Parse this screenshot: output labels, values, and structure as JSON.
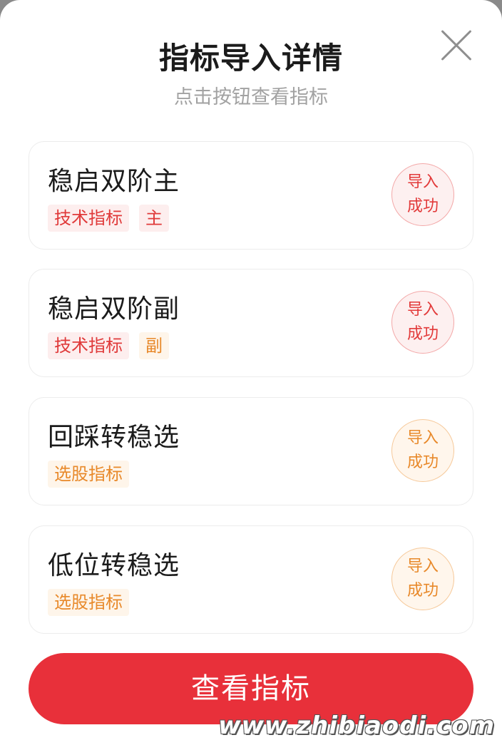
{
  "header": {
    "title": "指标导入详情",
    "subtitle": "点击按钮查看指标"
  },
  "items": [
    {
      "name": "稳启双阶主",
      "tags": [
        {
          "text": "技术指标",
          "color": "red"
        },
        {
          "text": "主",
          "color": "red"
        }
      ],
      "status": {
        "line1": "导入",
        "line2": "成功",
        "color": "red"
      }
    },
    {
      "name": "稳启双阶副",
      "tags": [
        {
          "text": "技术指标",
          "color": "red"
        },
        {
          "text": "副",
          "color": "orange"
        }
      ],
      "status": {
        "line1": "导入",
        "line2": "成功",
        "color": "red"
      }
    },
    {
      "name": "回踩转稳选",
      "tags": [
        {
          "text": "选股指标",
          "color": "orange"
        }
      ],
      "status": {
        "line1": "导入",
        "line2": "成功",
        "color": "orange"
      }
    },
    {
      "name": "低位转稳选",
      "tags": [
        {
          "text": "选股指标",
          "color": "orange"
        }
      ],
      "status": {
        "line1": "导入",
        "line2": "成功",
        "color": "orange"
      }
    }
  ],
  "action": {
    "label": "查看指标"
  },
  "watermark": "www.zhibiaodi.com",
  "colors": {
    "primary": "#e8303a",
    "tag_red": "#e03a3a",
    "tag_orange": "#e8892a"
  }
}
